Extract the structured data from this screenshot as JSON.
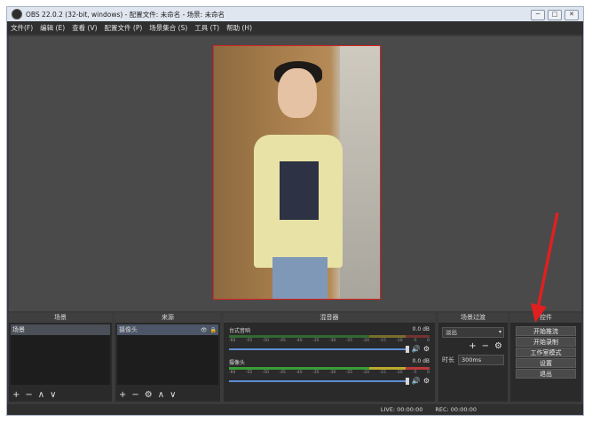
{
  "window": {
    "title": "OBS 22.0.2 (32-bit, windows) - 配置文件: 未命名 - 场景: 未命名",
    "controls": [
      "─",
      "□",
      "✕"
    ]
  },
  "menu": [
    "文件(F)",
    "编辑 (E)",
    "查看 (V)",
    "配置文件 (P)",
    "场景集合 (S)",
    "工具 (T)",
    "帮助 (H)"
  ],
  "docks": {
    "scenes": {
      "header": "场景",
      "items": [
        "场景"
      ]
    },
    "sources": {
      "header": "来源",
      "items": [
        "摄像头"
      ]
    },
    "mixer": {
      "header": "混音器",
      "tracks": [
        {
          "name": "台式音响",
          "db": "0.0 dB"
        },
        {
          "name": "摄像头",
          "db": "0.0 dB"
        }
      ],
      "scale": [
        "-60",
        "-55",
        "-50",
        "-45",
        "-40",
        "-35",
        "-30",
        "-25",
        "-20",
        "-15",
        "-10",
        "-5",
        "0"
      ]
    },
    "transitions": {
      "header": "场景过渡",
      "selected": "淡出",
      "duration_label": "时长",
      "duration_value": "300ms"
    },
    "controls": {
      "header": "控件",
      "buttons": [
        "开始推流",
        "开始录制",
        "工作室模式",
        "设置",
        "退出"
      ]
    }
  },
  "status": {
    "live": "LIVE: 00:00:00",
    "rec": "REC: 00:00:00"
  },
  "colors": {
    "accent": "#e02020",
    "background": "#3b3b3b",
    "selection": "#4c5668"
  }
}
